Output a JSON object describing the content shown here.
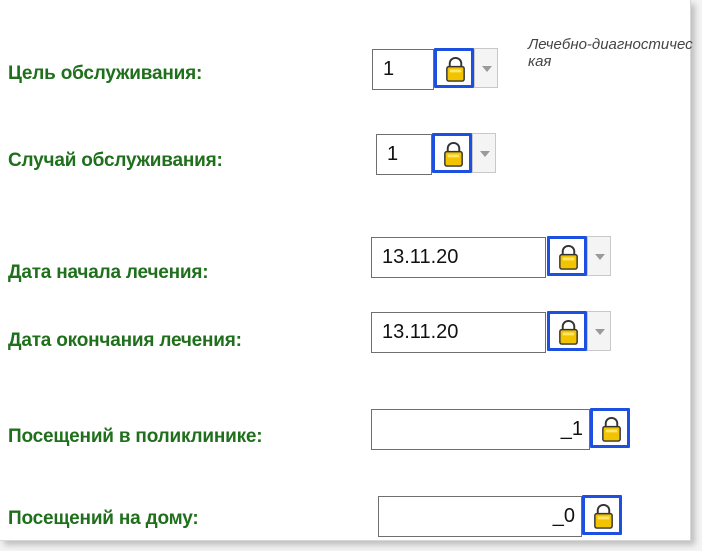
{
  "form": {
    "rows": [
      {
        "label": "Цель обслуживания:",
        "value": "1",
        "hint": "Лечебно-диагностическая"
      },
      {
        "label": "Случай обслуживания:",
        "value": "1"
      },
      {
        "label": "Дата начала лечения:",
        "value": "13.11.20"
      },
      {
        "label": "Дата окончания лечения:",
        "value": "13.11.20"
      },
      {
        "label": "Посещений в поликлинике:",
        "value": "_1"
      },
      {
        "label": "Посещений на дому:",
        "value": "_0"
      }
    ]
  },
  "icons": {
    "lock": "lock-icon",
    "dropdown": "chevron-down-icon"
  },
  "colors": {
    "label": "#1f6f1c",
    "highlight": "#1d4fe0",
    "lock_fill": "#f2c400"
  }
}
